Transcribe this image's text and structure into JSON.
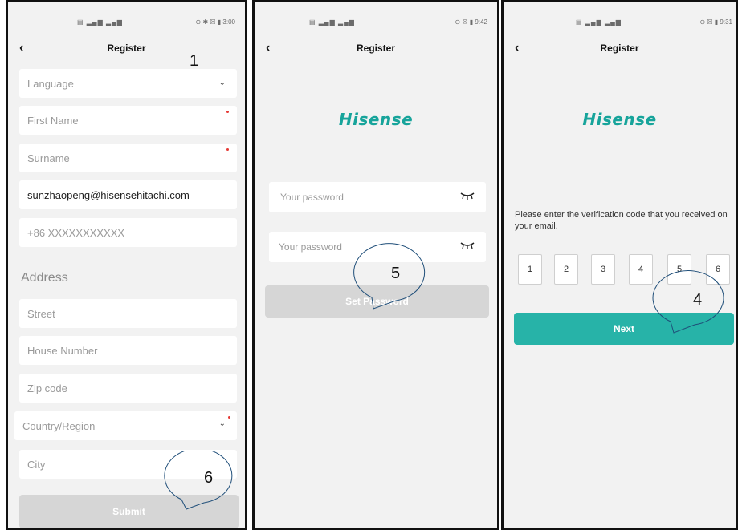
{
  "screens": [
    {
      "status_right": "⊙ ✱ ☒ ▮ 3:00",
      "title": "Register",
      "frame_number": "1",
      "fields": [
        {
          "text": "Language",
          "type": "select"
        },
        {
          "text": "First Name",
          "type": "placeholder",
          "required": true
        },
        {
          "text": "Surname",
          "type": "placeholder",
          "required": true
        },
        {
          "text": "sunzhaopeng@hisensehitachi.com",
          "type": "value"
        },
        {
          "text": "+86 XXXXXXXXXXX",
          "type": "placeholder"
        }
      ],
      "section_title": "Address",
      "address_fields": [
        {
          "text": "Street"
        },
        {
          "text": "House Number"
        },
        {
          "text": "Zip code"
        },
        {
          "text": "Country/Region",
          "type": "select",
          "required": true
        },
        {
          "text": "City"
        }
      ],
      "button": "Submit",
      "callout": "6"
    },
    {
      "status_right": "⊙ ☒ ▮ 9:42",
      "title": "Register",
      "logo": "Hisense",
      "password_placeholder": "Your password",
      "password_confirm_placeholder": "Your password",
      "button": "Set Password",
      "callout": "5"
    },
    {
      "status_right": "⊙ ☒ ▮ 9:31",
      "title": "Register",
      "logo": "Hisense",
      "info": "Please enter the verification code that you received on your email.",
      "codes": [
        "1",
        "2",
        "3",
        "4",
        "5",
        "6"
      ],
      "button": "Next",
      "callout": "4"
    }
  ],
  "colors": {
    "accent": "#27b3a8",
    "logo": "#17a49b",
    "disabled_button": "#d6d6d6",
    "required_dot": "#e53935",
    "frame_border": "#111111"
  },
  "icons": [
    "back-chevron-icon",
    "chevron-down-icon",
    "eye-closed-icon"
  ]
}
